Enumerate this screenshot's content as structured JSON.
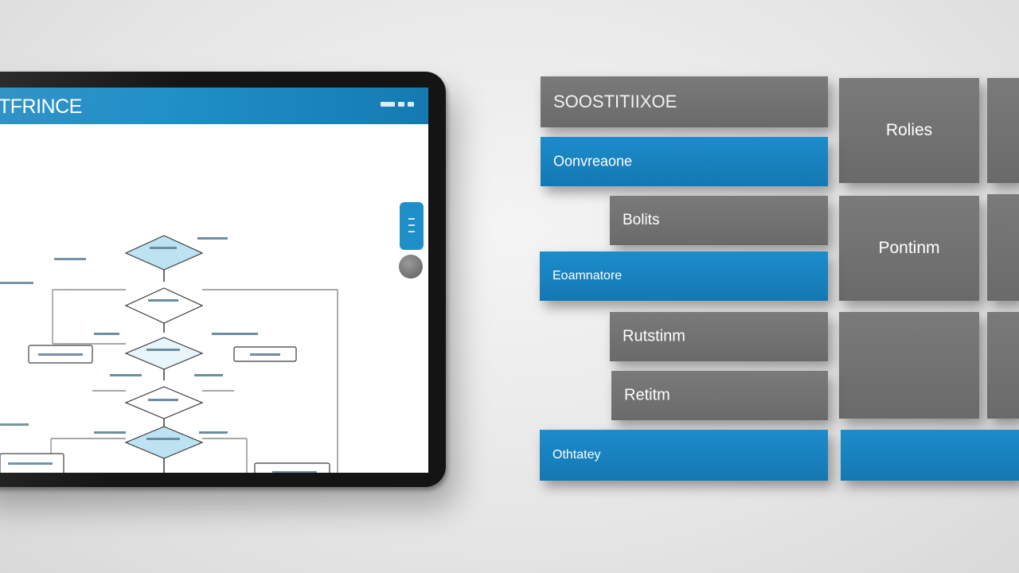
{
  "tablet": {
    "title": "TFRINCE",
    "flowchart": {
      "node_fill": "#bde3f3",
      "line_color": "#2a2a2a"
    }
  },
  "blocks": {
    "header_label": "SOOSTITIIXOE",
    "roles": "Rolies",
    "convergence": "Oonvreaone",
    "bolts": "Bolits",
    "pontinm": "Pontinm",
    "examples": "Eoamnatore",
    "rutstinm": "Rutstinm",
    "retitm": "Retitm",
    "otherwise": "Othtatey"
  },
  "colors": {
    "accent_blue": "#1a86c0",
    "block_gray": "#6e6e6e",
    "block_dark": "#1c1c1c",
    "background": "#e8e8e8"
  }
}
